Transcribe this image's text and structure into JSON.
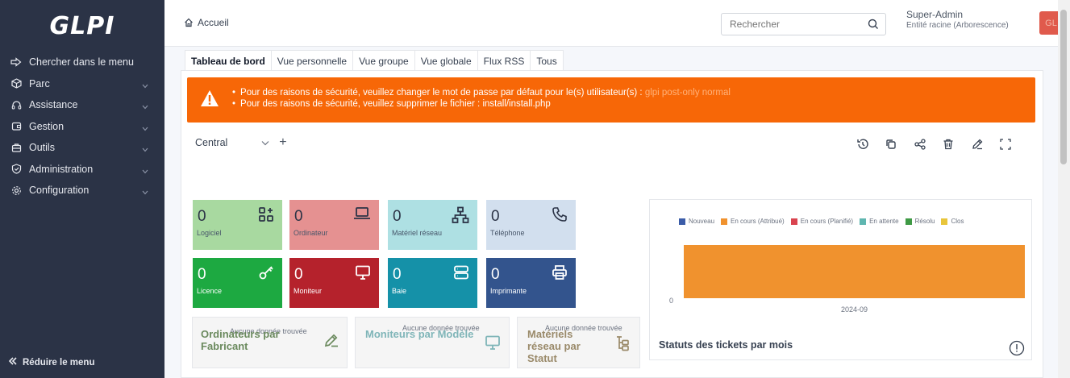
{
  "sidebar": {
    "logo": "GLPI",
    "items": [
      {
        "label": "Chercher dans le menu",
        "icon": "arrow-right-icon",
        "chevron": false
      },
      {
        "label": "Parc",
        "icon": "cube-icon",
        "chevron": true
      },
      {
        "label": "Assistance",
        "icon": "headset-icon",
        "chevron": true
      },
      {
        "label": "Gestion",
        "icon": "wallet-icon",
        "chevron": true
      },
      {
        "label": "Outils",
        "icon": "briefcase-icon",
        "chevron": true
      },
      {
        "label": "Administration",
        "icon": "shield-icon",
        "chevron": true
      },
      {
        "label": "Configuration",
        "icon": "gear-icon",
        "chevron": true
      }
    ],
    "collapse_label": "Réduire le menu"
  },
  "header": {
    "breadcrumb": "Accueil",
    "search_placeholder": "Rechercher",
    "user_name": "Super-Admin",
    "user_entity": "Entité racine (Arborescence)",
    "avatar_initials": "GL"
  },
  "tabs": [
    "Tableau de bord",
    "Vue personnelle",
    "Vue groupe",
    "Vue globale",
    "Flux RSS",
    "Tous"
  ],
  "alert": {
    "line1_prefix": "Pour des raisons de sécurité, veuillez changer le mot de passe par défaut pour le(s) utilisateur(s) : ",
    "line1_users": "glpi post-only normal",
    "line2": "Pour des raisons de sécurité, veuillez supprimer le fichier : install/install.php"
  },
  "dashboard": {
    "selected": "Central",
    "add": "+"
  },
  "tiles": [
    {
      "value": "0",
      "label": "Logiciel",
      "color": "#a8d9a0",
      "icon": "apps-add-icon",
      "light": true
    },
    {
      "value": "0",
      "label": "Ordinateur",
      "color": "#e59191",
      "icon": "laptop-icon",
      "light": true
    },
    {
      "value": "0",
      "label": "Matériel réseau",
      "color": "#aee0e3",
      "icon": "network-icon",
      "light": true
    },
    {
      "value": "0",
      "label": "Téléphone",
      "color": "#d2dfee",
      "icon": "phone-icon",
      "light": true
    },
    {
      "value": "0",
      "label": "Licence",
      "color": "#1da941",
      "icon": "key-icon",
      "light": false
    },
    {
      "value": "0",
      "label": "Moniteur",
      "color": "#b5222c",
      "icon": "monitor-icon",
      "light": false
    },
    {
      "value": "0",
      "label": "Baie",
      "color": "#1591a8",
      "icon": "server-icon",
      "light": false
    },
    {
      "value": "0",
      "label": "Imprimante",
      "color": "#33548d",
      "icon": "printer-icon",
      "light": false
    }
  ],
  "cards": [
    {
      "nodata": "Aucune donnée trouvée",
      "title": "Ordinateurs par Fabricant",
      "title_color": "#6b8a5e",
      "icon": "edit-icon"
    },
    {
      "nodata": "Aucune donnée trouvée",
      "title": "Moniteurs par Modèle",
      "title_color": "#7fb5b8",
      "icon": "monitor-icon"
    },
    {
      "nodata": "Aucune donnée trouvée",
      "title": "Matériels réseau par Statut",
      "title_color": "#9a8a6a",
      "icon": "hierarchy-icon"
    }
  ],
  "chart_data": {
    "type": "bar",
    "title": "Statuts des tickets par mois",
    "categories": [
      "2024-09"
    ],
    "series": [
      {
        "name": "Nouveau",
        "color": "#3b5ca8",
        "values": [
          0
        ]
      },
      {
        "name": "En cours (Attribué)",
        "color": "#f0922e",
        "values": [
          0
        ]
      },
      {
        "name": "En cours (Planifié)",
        "color": "#d9434f",
        "values": [
          0
        ]
      },
      {
        "name": "En attente",
        "color": "#5fb6b0",
        "values": [
          0
        ]
      },
      {
        "name": "Résolu",
        "color": "#3f9a45",
        "values": [
          0
        ]
      },
      {
        "name": "Clos",
        "color": "#e8c53b",
        "values": [
          0
        ]
      }
    ],
    "yticks": [
      "0"
    ],
    "grid": false,
    "legend": "top"
  }
}
